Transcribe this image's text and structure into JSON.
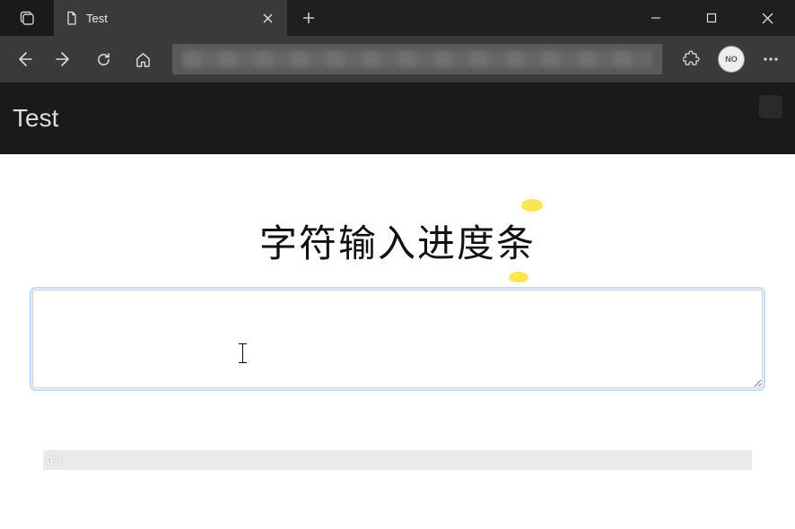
{
  "window": {
    "tab_title": "Test"
  },
  "header": {
    "title": "Test"
  },
  "main": {
    "heading": "字符输入进度条",
    "textarea_value": "",
    "progress_percent_label": "0%"
  }
}
